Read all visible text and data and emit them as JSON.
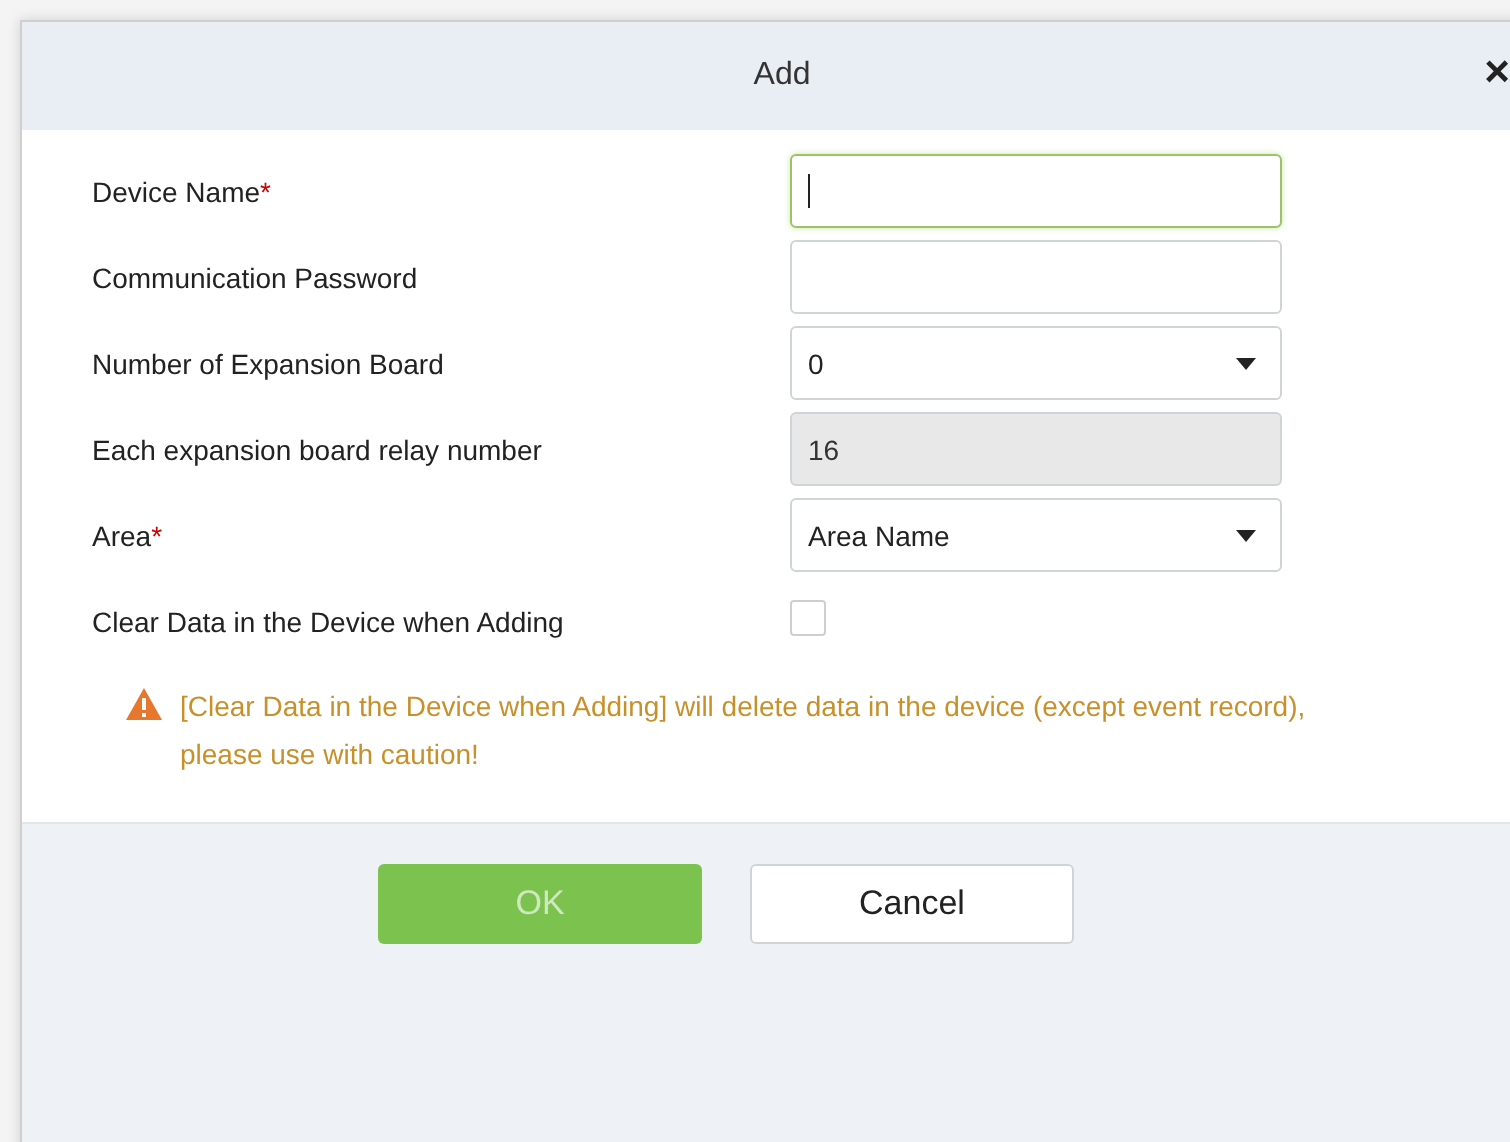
{
  "dialog": {
    "title": "Add",
    "close": "×"
  },
  "fields": [
    {
      "kind": "text",
      "label": "Device Name",
      "required_mark": "*",
      "focused": true
    },
    {
      "kind": "password",
      "label": "Communication Password"
    },
    {
      "kind": "select",
      "label": "Number of Expansion Board",
      "value": "0"
    },
    {
      "kind": "readonly",
      "label": "Each expansion board relay number",
      "value": "16"
    },
    {
      "kind": "select",
      "label": "Area",
      "required_mark": "*",
      "value": "Area Name"
    },
    {
      "kind": "checkbox",
      "label": "Clear Data in the Device when Adding",
      "checked": false
    }
  ],
  "warning": "[Clear Data in the Device when Adding] will delete data in the device (except event record), please use with caution!",
  "buttons": [
    {
      "kind": "primary",
      "label": "OK",
      "disabled": true
    },
    {
      "kind": "secondary",
      "label": "Cancel",
      "disabled": false
    }
  ]
}
